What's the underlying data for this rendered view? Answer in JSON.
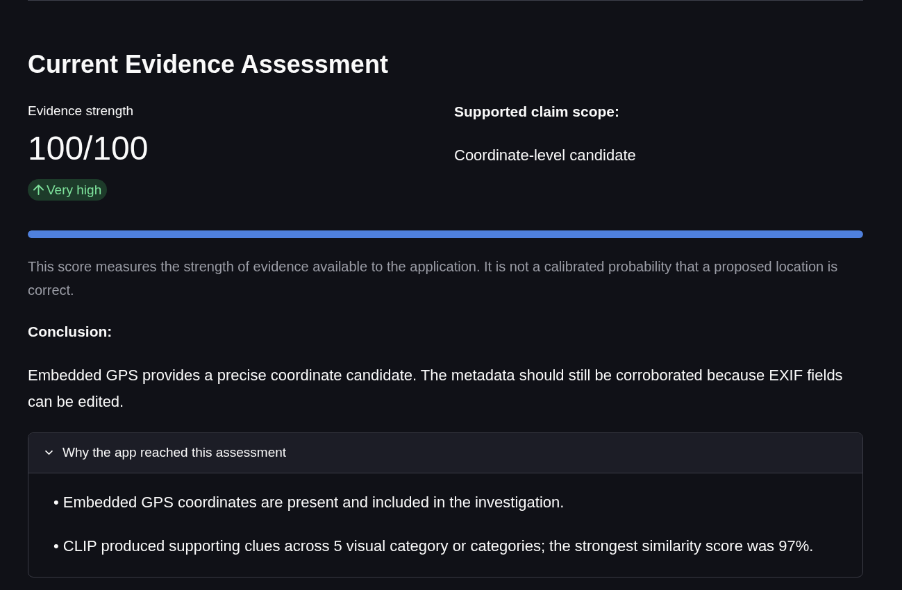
{
  "title": "Current Evidence Assessment",
  "metric": {
    "label": "Evidence strength",
    "value": "100/100",
    "delta": {
      "kind": "up",
      "text": "Very high"
    }
  },
  "scope": {
    "label": "Supported claim scope:",
    "value": "Coordinate-level candidate"
  },
  "progress": {
    "level": 1.0
  },
  "caption": "This score measures the strength of evidence available to the application. It is not a calibrated probability that a proposed location is correct.",
  "conclusion": {
    "label": "Conclusion:",
    "text": "Embedded GPS provides a precise coordinate candidate. The metadata should still be corroborated because EXIF fields can be edited."
  },
  "expander": {
    "title": "Why the app reached this assessment",
    "expanded": true,
    "items": [
      "• Embedded GPS coordinates are present and included in the investigation.",
      "• CLIP produced supporting clues across 5 visual category or categories; the strongest similarity score was 97%."
    ]
  }
}
